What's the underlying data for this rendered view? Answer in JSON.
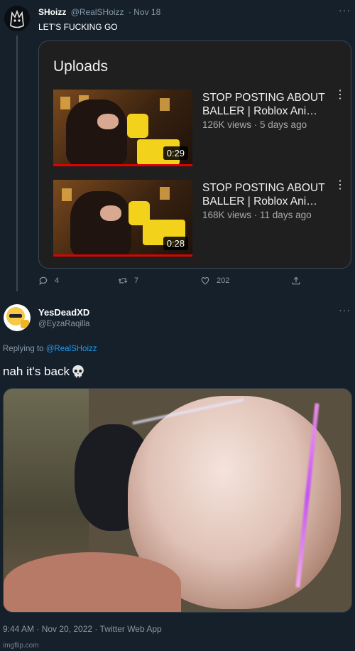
{
  "tweet1": {
    "display_name": "SHoizz",
    "handle": "@RealSHoizz",
    "date": "· Nov 18",
    "text": "LET'S FUCKING GO",
    "card": {
      "title": "Uploads",
      "videos": [
        {
          "title": "STOP POSTING ABOUT BALLER | Roblox Ani…",
          "meta": "126K views · 5 days ago",
          "duration": "0:29"
        },
        {
          "title": "STOP POSTING ABOUT BALLER | Roblox Ani…",
          "meta": "168K views · 11 days ago",
          "duration": "0:28"
        }
      ]
    },
    "actions": {
      "replies": "4",
      "retweets": "7",
      "likes": "202"
    }
  },
  "tweet2": {
    "display_name": "YesDeadXD",
    "handle": "@EyzaRaqilla",
    "replying_prefix": "Replying to",
    "replying_to": "@RealSHoizz",
    "text": "nah it's back",
    "timestamp": "9:44 AM · Nov 20, 2022 · Twitter Web App"
  },
  "watermark": "imgflip.com",
  "colors": {
    "background": "#15202b",
    "link": "#1d9bf0",
    "muted": "#8899a6",
    "card_bg": "#1f1f1f",
    "progress_red": "#e00000"
  },
  "icons": {
    "more": "more-horizontal-icon",
    "reply": "reply-icon",
    "retweet": "retweet-icon",
    "like": "heart-icon",
    "share": "share-icon",
    "skull": "skull-emoji-icon",
    "video_more": "more-vertical-icon"
  }
}
